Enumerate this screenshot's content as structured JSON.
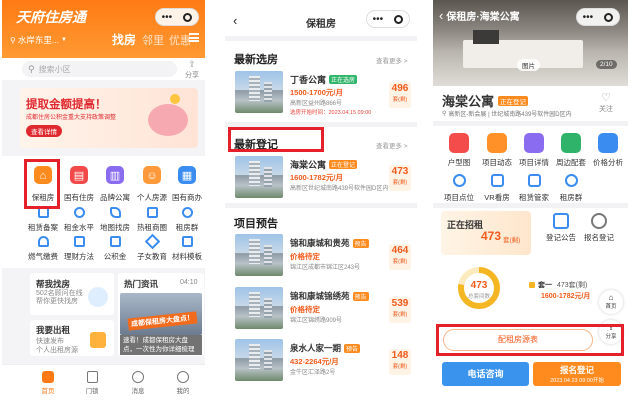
{
  "screen1": {
    "brand_title": "天府住房通",
    "location": "水岸东里...",
    "nav_tabs": [
      "找房",
      "邻里",
      "优惠"
    ],
    "menu_icon": "menu-icon",
    "search_placeholder": "搜索小区",
    "share_label": "分享",
    "banner": {
      "headline": "提取金额提高！",
      "subline": "成都住房公积金重大支持政策调整",
      "button": "查看详情"
    },
    "grid_row1": [
      "保租房",
      "国有住房",
      "品牌公寓",
      "个人房源",
      "国有商办"
    ],
    "grid_row2": [
      "租赁备案",
      "租金水平",
      "地图找房",
      "热租商圈",
      "租房群"
    ],
    "grid_row3": [
      "燃气缴费",
      "理财方法",
      "公积金",
      "子女教育",
      "材料模板"
    ],
    "help_card": {
      "title": "帮我找房",
      "sub": "502名顾问在线 帮你更快找房"
    },
    "hot_card": {
      "title": "热门资讯",
      "time": "04:10"
    },
    "rent_card": {
      "title": "我要出租",
      "sub1": "快速发布",
      "sub2": "个人出租房源"
    },
    "news_image_title": "成都保租房大盘点！",
    "news_caption": "速看！成都保租房大盘点，一次性为你详细梳理",
    "bottom_nav": [
      "首页",
      "门锁",
      "消息",
      "我的"
    ]
  },
  "screen2": {
    "header_title": "保租房",
    "sections": {
      "latest_select": "最新选房",
      "latest_register": "最新登记",
      "project_preview": "项目预告"
    },
    "see_more": "查看更多 >",
    "select_item": {
      "name": "丁香公寓",
      "tag": "正在选房",
      "price": "1500-1700元/月",
      "address": "高新区益州路866号",
      "status": "选房开始时间：2023.04.15 09:00",
      "remaining": "496",
      "remaining_label": "套(剩)"
    },
    "register_item": {
      "name": "海棠公寓",
      "tag": "正在登记",
      "price": "1600-1782元/月",
      "address": "高新区世纪城南路439号软件园D区内",
      "remaining": "473",
      "remaining_label": "套(剩)"
    },
    "preview_items": [
      {
        "name": "锦和康城和贵苑",
        "tag": "预告",
        "price": "价格待定",
        "address": "锦江区成都市锦江区243号",
        "remaining": "464",
        "remaining_label": "套(剩)"
      },
      {
        "name": "锦和康城锦绣苑",
        "tag": "预告",
        "price": "价格待定",
        "address": "锦江区锦绣路909号",
        "remaining": "539",
        "remaining_label": "套(剩)"
      },
      {
        "name": "泉水人家一期",
        "tag": "预告",
        "price": "432-2264元/月",
        "address": "金牛区汇泽路2号",
        "remaining": "148",
        "remaining_label": "套(剩)"
      }
    ]
  },
  "screen3": {
    "header_title": "保租房·海棠公寓",
    "image_label": "图片",
    "image_index": "2/10",
    "name": "海棠公寓",
    "tag": "正在登记",
    "address": "高新区-新会展 | 世纪城南路439号软件园D区内",
    "follow_label": "关注",
    "features_row1": [
      "户型图",
      "项目动态",
      "项目详情",
      "周边配套",
      "价格分析"
    ],
    "features_row2": [
      "项目点位",
      "VR看房",
      "租赁管家",
      "租房群"
    ],
    "recruit": {
      "title": "正在招租",
      "count": "473",
      "unit": "套(剩)",
      "actions": [
        "登记公告",
        "报名登记"
      ]
    },
    "ring": {
      "value": "473",
      "label": "总套间数",
      "fraction": 0.78
    },
    "room_type": {
      "name": "套一",
      "count": "473套(剩)",
      "price": "1600-1782元/月"
    },
    "home_label": "首页",
    "share_label": "分享",
    "rent_list_button": "配租房源表",
    "call_button": "电话咨询",
    "register_button": "报名登记",
    "register_time": "2023.04.23 09:00开始"
  },
  "colors": {
    "brand_orange": "#ff7a14",
    "price_orange": "#f05a1a",
    "highlight_red": "#e5202a",
    "call_blue": "#3a93ec"
  }
}
